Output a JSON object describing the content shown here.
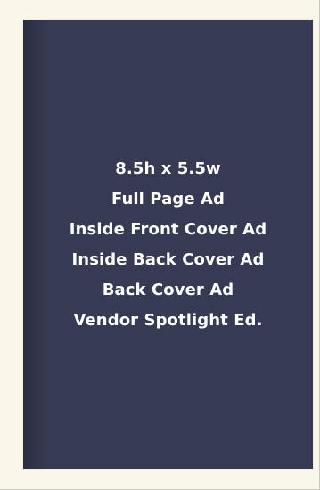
{
  "booklet": {
    "lines": [
      "8.5h x 5.5w",
      "Full Page Ad",
      "Inside Front Cover Ad",
      "Inside Back Cover Ad",
      "Back Cover Ad",
      "Vendor Spotlight Ed."
    ],
    "background_color": "#363a52",
    "text_color": "#ffffff",
    "page_background_color": "#fbf6ea"
  }
}
